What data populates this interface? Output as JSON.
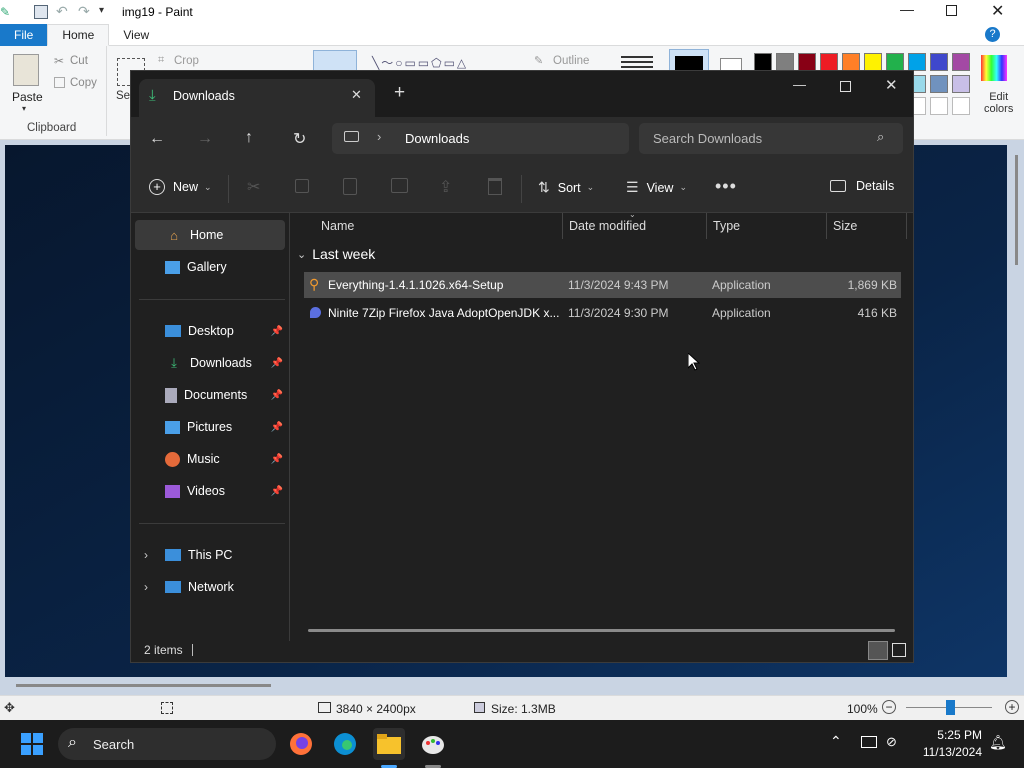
{
  "paint": {
    "title": "img19 - Paint",
    "tabs": [
      {
        "label": "File"
      },
      {
        "label": "Home"
      },
      {
        "label": "View"
      }
    ],
    "ribbon": {
      "paste": "Paste",
      "cut": "Cut",
      "copy": "Copy",
      "select_partial": "Se",
      "crop": "Crop",
      "outline": "Outline",
      "clipboard_group": "Clipboard",
      "edit_colors_1": "Edit",
      "edit_colors_2": "colors"
    },
    "palette": [
      "#000000",
      "#7f7f7f",
      "#880015",
      "#ed1c24",
      "#ff7f27",
      "#fff200",
      "#22b14c",
      "#00a2e8",
      "#3f48cc",
      "#a349a4"
    ],
    "palette_row2": [
      "#99d9ea",
      "#7092be",
      "#c8bfe7"
    ],
    "status": {
      "dimensions": "3840 × 2400px",
      "size": "Size: 1.3MB",
      "zoom": "100%"
    }
  },
  "explorer": {
    "tab_title": "Downloads",
    "address": "Downloads",
    "search_placeholder": "Search Downloads",
    "toolbar": {
      "new": "New",
      "sort": "Sort",
      "view": "View",
      "details": "Details"
    },
    "nav": {
      "home": "Home",
      "gallery": "Gallery",
      "desktop": "Desktop",
      "downloads": "Downloads",
      "documents": "Documents",
      "pictures": "Pictures",
      "music": "Music",
      "videos": "Videos",
      "this_pc": "This PC",
      "network": "Network"
    },
    "columns": {
      "name": "Name",
      "date": "Date modified",
      "type": "Type",
      "size": "Size"
    },
    "group": "Last week",
    "files": [
      {
        "name": "Everything-1.4.1.1026.x64-Setup",
        "date": "11/3/2024 9:43 PM",
        "type": "Application",
        "size": "1,869 KB"
      },
      {
        "name": "Ninite 7Zip Firefox Java AdoptOpenJDK x...",
        "date": "11/3/2024 9:30 PM",
        "type": "Application",
        "size": "416 KB"
      }
    ],
    "status": "2 items"
  },
  "taskbar": {
    "search": "Search",
    "time": "5:25 PM",
    "date": "11/13/2024"
  }
}
